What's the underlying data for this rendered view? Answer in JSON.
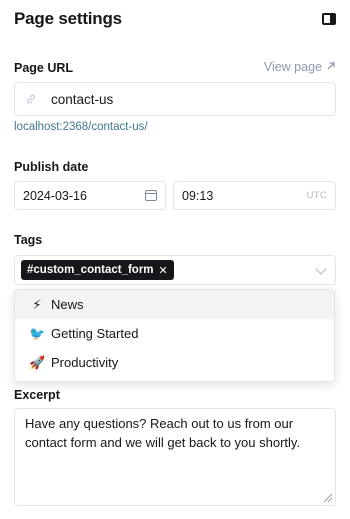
{
  "header": {
    "title": "Page settings",
    "toggle_icon": "sidebar-toggle-icon"
  },
  "url": {
    "label": "Page URL",
    "view_link": "View page",
    "view_icon": "external-link-icon",
    "value": "contact-us",
    "hint": "localhost:2368/contact-us/"
  },
  "publish": {
    "label": "Publish date",
    "date": "2024-03-16",
    "time": "09:13",
    "tz": "UTC"
  },
  "tags": {
    "label": "Tags",
    "selected": "#custom_contact_form",
    "remove": "✕",
    "options": [
      {
        "label": "News",
        "icon": "⚡",
        "active": true
      },
      {
        "label": "Getting Started",
        "icon": "🐦",
        "active": false
      },
      {
        "label": "Productivity",
        "icon": "🚀",
        "active": false
      }
    ]
  },
  "excerpt": {
    "label": "Excerpt",
    "value": "Have any questions? Reach out to us from our contact form and we will get back to you shortly."
  },
  "colors": {
    "accent": "#15171a",
    "hint": "#3f7a8c",
    "muted": "#8e9cac"
  }
}
